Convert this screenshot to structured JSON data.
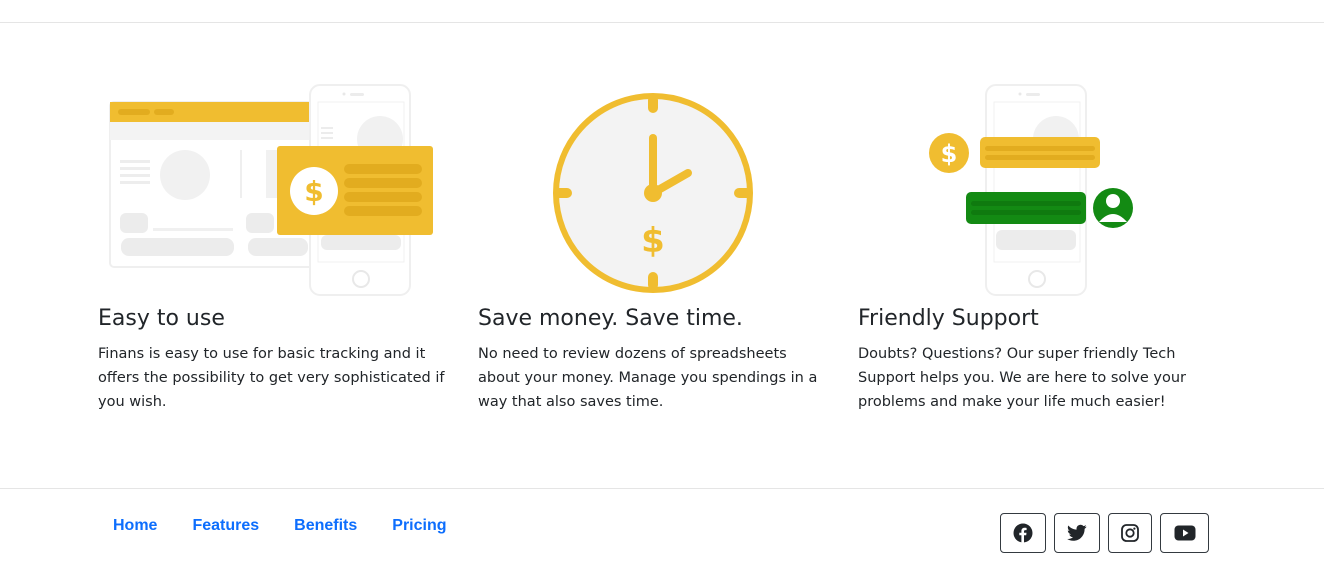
{
  "features": [
    {
      "title": "Easy to use",
      "text": "Finans is easy to use for basic tracking and it offers the possibility to get very sophisticated if you wish.",
      "illustration": "dashboard-and-phone-dollar-icon"
    },
    {
      "title": "Save money. Save time.",
      "text": "No need to review dozens of spreadsheets about your money. Manage you spendings in a way that also saves time.",
      "illustration": "clock-dollar-icon"
    },
    {
      "title": "Friendly Support",
      "text": "Doubts? Questions? Our super friendly Tech Support helps you. We are here to solve your problems and make your life much easier!",
      "illustration": "phone-chat-support-icon"
    }
  ],
  "footer": {
    "nav": [
      "Home",
      "Features",
      "Benefits",
      "Pricing"
    ],
    "social": [
      "facebook-icon",
      "twitter-icon",
      "instagram-icon",
      "youtube-icon"
    ]
  },
  "colors": {
    "accent_yellow": "#f0bd30",
    "accent_yellow_dark": "#e2ac1f",
    "support_green": "#138a13",
    "link_blue": "#0d6efd",
    "placeholder_gray": "#ececec"
  }
}
